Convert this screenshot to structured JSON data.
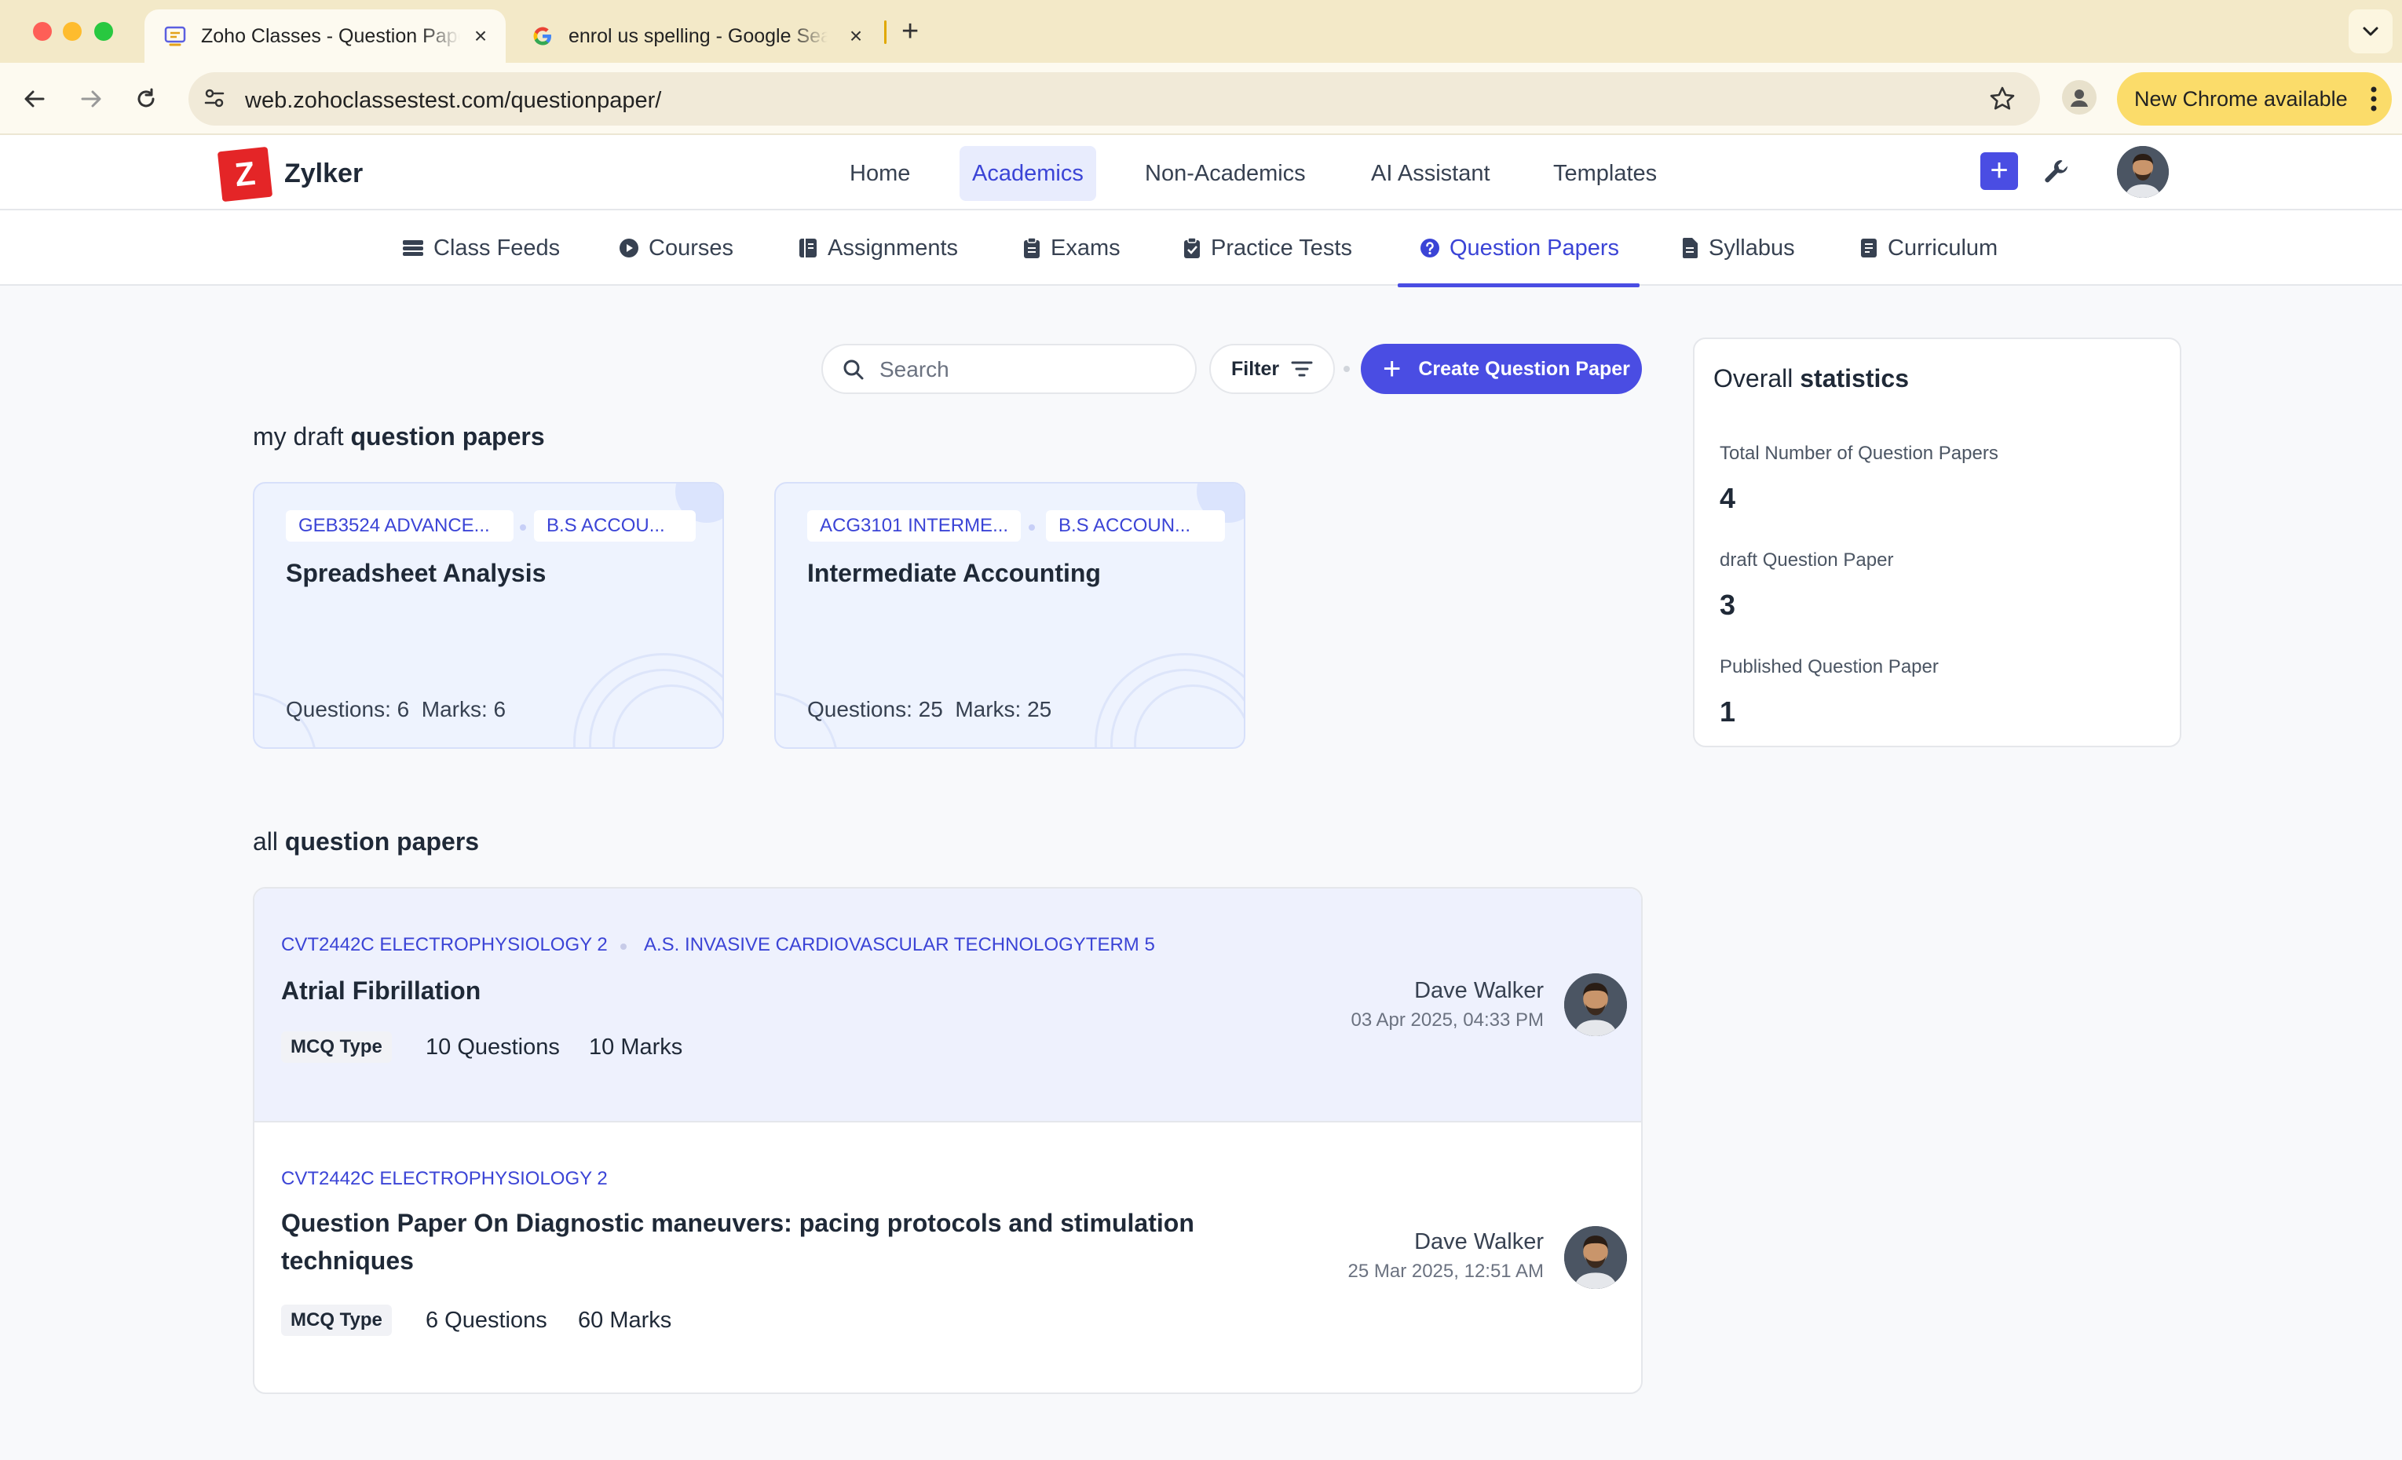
{
  "browser": {
    "tabs": [
      {
        "title": "Zoho Classes - Question Papers",
        "active": true
      },
      {
        "title": "enrol us spelling - Google Search",
        "active": false
      }
    ],
    "url": "web.zohoclassestest.com/questionpaper/",
    "update_label": "New Chrome available"
  },
  "header": {
    "brand": "Zylker",
    "logo_letter": "Z",
    "nav": [
      "Home",
      "Academics",
      "Non-Academics",
      "AI Assistant",
      "Templates"
    ],
    "active_nav": "Academics",
    "add_label": "+"
  },
  "subnav": {
    "items": [
      "Class Feeds",
      "Courses",
      "Assignments",
      "Exams",
      "Practice Tests",
      "Question Papers",
      "Syllabus",
      "Curriculum"
    ],
    "active": "Question Papers"
  },
  "toolbar": {
    "search_placeholder": "Search",
    "filter_label": "Filter",
    "create_label": "Create Question Paper",
    "create_icon": "+"
  },
  "drafts": {
    "heading_prefix": "my draft",
    "heading_bold": "question papers",
    "cards": [
      {
        "course": "GEB3524 ADVANCE...",
        "program": "B.S ACCOU...",
        "title": "Spreadsheet Analysis",
        "meta": "Questions: 6  Marks: 6"
      },
      {
        "course": "ACG3101 INTERME...",
        "program": "B.S ACCOUN...",
        "title": "Intermediate Accounting",
        "meta": "Questions: 25  Marks: 25"
      }
    ]
  },
  "stats": {
    "heading_prefix": "Overall",
    "heading_bold": "statistics",
    "items": [
      {
        "label": "Total Number of Question Papers",
        "value": "4"
      },
      {
        "label": "draft Question Paper",
        "value": "3"
      },
      {
        "label": "Published Question Paper",
        "value": "1"
      }
    ]
  },
  "all": {
    "heading_prefix": "all",
    "heading_bold": "question papers",
    "rows": [
      {
        "course": "CVT2442C ELECTROPHYSIOLOGY 2",
        "program": "A.S. INVASIVE CARDIOVASCULAR TECHNOLOGYTERM 5",
        "title": "Atrial Fibrillation",
        "type": "MCQ Type",
        "questions": "10 Questions",
        "marks": "10 Marks",
        "author": "Dave Walker",
        "date": "03 Apr 2025, 04:33 PM"
      },
      {
        "course": "CVT2442C ELECTROPHYSIOLOGY 2",
        "title": "Question Paper On Diagnostic maneuvers: pacing protocols and stimulation techniques",
        "type": "MCQ Type",
        "questions": "6 Questions",
        "marks": "60 Marks",
        "author": "Dave Walker",
        "date": "25 Mar 2025, 12:51 AM"
      }
    ]
  },
  "colors": {
    "accent": "#4a4de3",
    "draft_card_bg": "#eef3fe",
    "highlight_row_bg": "#eef1fd",
    "logo_red": "#e42527",
    "tabbar_bg": "#f3e9c8"
  }
}
